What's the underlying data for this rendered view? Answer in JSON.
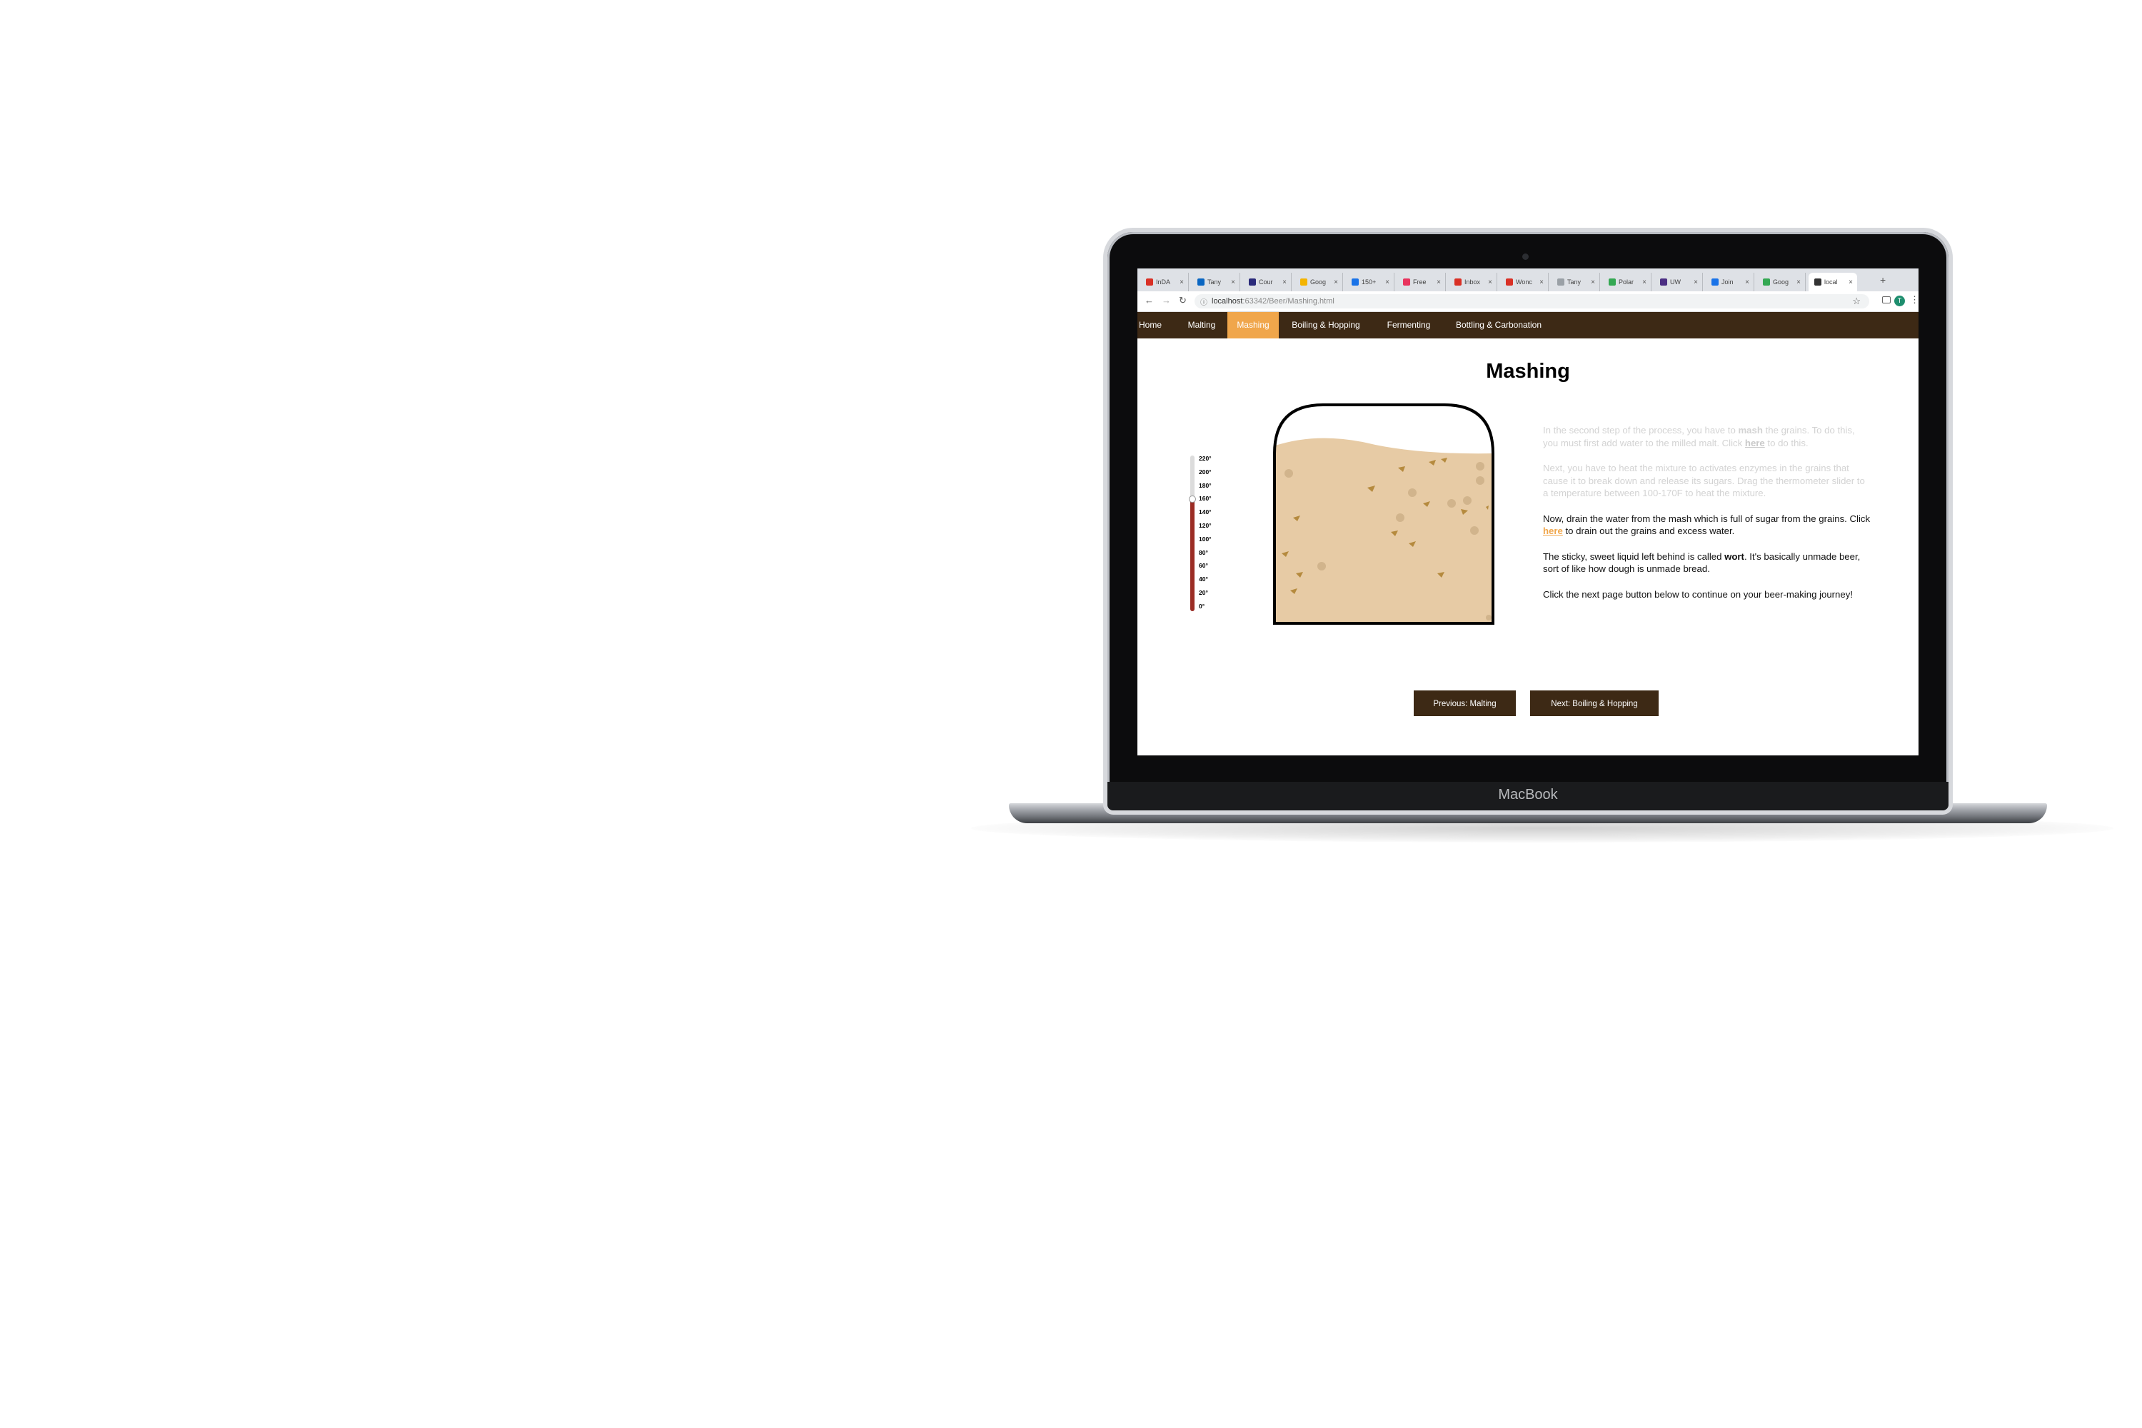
{
  "device": {
    "brand": "MacBook"
  },
  "browser": {
    "tabs": [
      {
        "label": "InDA",
        "color": "#d93025"
      },
      {
        "label": "Tany",
        "color": "#0a66c2"
      },
      {
        "label": "Cour",
        "color": "#2a2a7a"
      },
      {
        "label": "Goog",
        "color": "#f4b400"
      },
      {
        "label": "150+",
        "color": "#1a73e8"
      },
      {
        "label": "Free",
        "color": "#e8335d"
      },
      {
        "label": "Inbox",
        "color": "#d93025"
      },
      {
        "label": "Wonc",
        "color": "#d93025"
      },
      {
        "label": "Tany",
        "color": "#9aa0a6"
      },
      {
        "label": "Polar",
        "color": "#34a853"
      },
      {
        "label": "UW",
        "color": "#4b2e83"
      },
      {
        "label": "Join",
        "color": "#1a73e8"
      },
      {
        "label": "Goog",
        "color": "#34a853"
      },
      {
        "label": "local",
        "color": "#333333"
      }
    ],
    "active_tab_index": 13,
    "url_host": "localhost",
    "url_rest": ":63342/Beer/Mashing.html",
    "profile_initial": "T"
  },
  "site": {
    "nav": [
      {
        "label": "Home"
      },
      {
        "label": "Malting"
      },
      {
        "label": "Mashing"
      },
      {
        "label": "Boiling & Hopping"
      },
      {
        "label": "Fermenting"
      },
      {
        "label": "Bottling & Carbonation"
      }
    ],
    "active_nav": "Mashing",
    "accent_color": "#f0a64b",
    "nav_bg_color": "#3d2915"
  },
  "page": {
    "title": "Mashing",
    "thermometer": {
      "labels": [
        "220°",
        "200°",
        "180°",
        "160°",
        "140°",
        "120°",
        "100°",
        "80°",
        "60°",
        "40°",
        "20°",
        "0°"
      ],
      "value_fraction": 0.72
    },
    "paragraphs": {
      "p1_a": "In the second step of the process, you have to ",
      "p1_b": "mash",
      "p1_c": " the grains. To do this, you must first add water to the milled malt. Click ",
      "p1_link": "here",
      "p1_d": " to do this.",
      "p2": "Next, you have to heat the mixture to activates enzymes in the grains that cause it to break down and release its sugars. Drag the thermometer slider to a temperature between 100-170F to heat the mixture.",
      "p3_a": "Now, drain the water from the mash which is full of sugar from the grains. Click ",
      "p3_link": "here",
      "p3_b": " to drain out the grains and excess water.",
      "p4_a": "The sticky, sweet liquid left behind is called ",
      "p4_b": "wort",
      "p4_c": ". It's basically unmade beer, sort of like how dough is unmade bread.",
      "p5": "Click the next page button below to continue on your beer-making journey!"
    },
    "buttons": {
      "previous": "Previous: Malting",
      "next": "Next: Boiling & Hopping"
    }
  }
}
